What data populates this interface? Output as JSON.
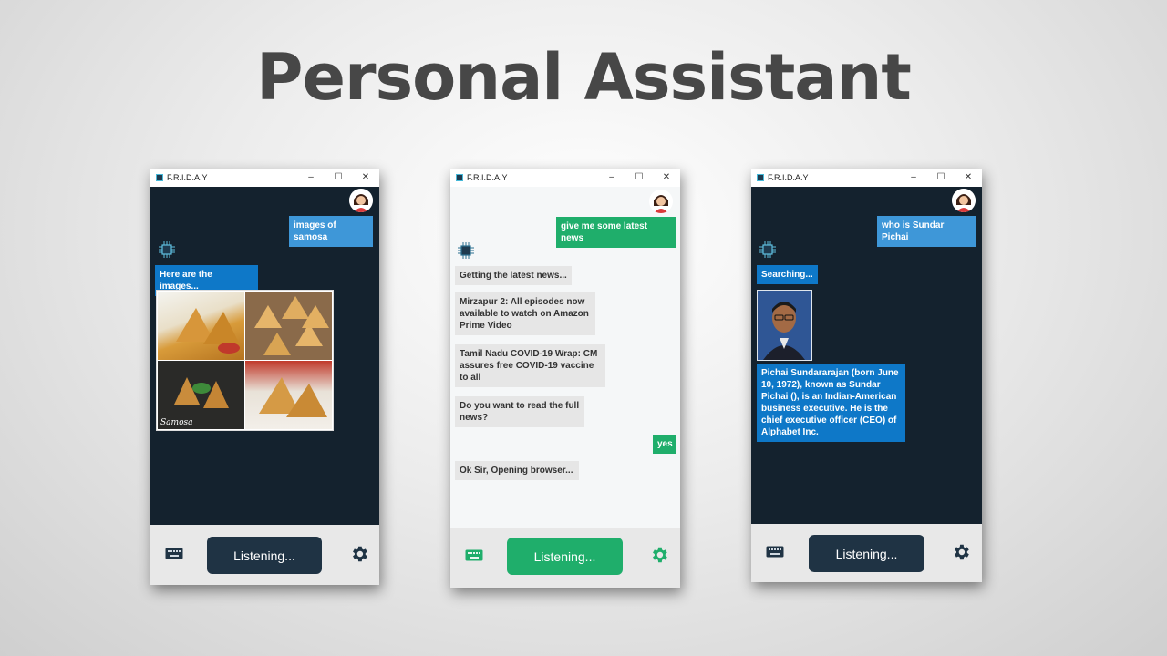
{
  "headline": "Personal Assistant",
  "window_title": "F.R.I.D.A.Y",
  "window_controls": [
    "–",
    "☐",
    "✕"
  ],
  "status_label": "Listening...",
  "windows": [
    {
      "theme": "dark",
      "messages": {
        "user_1": "images of samosa",
        "bot_1": "Here are the images...",
        "image_caption": "Samosa"
      }
    },
    {
      "theme": "light",
      "messages": {
        "user_1": "give me some latest news",
        "bot_1": "Getting the latest news...",
        "bot_2": "Mirzapur 2: All episodes now available to watch on Amazon Prime Video",
        "bot_3": "Tamil Nadu COVID-19 Wrap: CM assures free COVID-19 vaccine to all",
        "bot_4": "Do you want to read the full news?",
        "user_2": "yes",
        "bot_5": "Ok Sir, Opening browser..."
      }
    },
    {
      "theme": "dark",
      "messages": {
        "user_1": "who is Sundar Pichai",
        "bot_1": "Searching...",
        "bot_2": "Pichai Sundararajan (born June 10, 1972), known as Sundar Pichai (), is an Indian-American business executive. He is the chief executive officer (CEO) of Alphabet Inc."
      }
    }
  ],
  "colors": {
    "dark_chat_bg": "#14222e",
    "light_chat_bg": "#f5f7f8",
    "dark_button": "#1f3344",
    "green_button": "#1fae6b",
    "blue_bubble": "#0e78c8"
  }
}
